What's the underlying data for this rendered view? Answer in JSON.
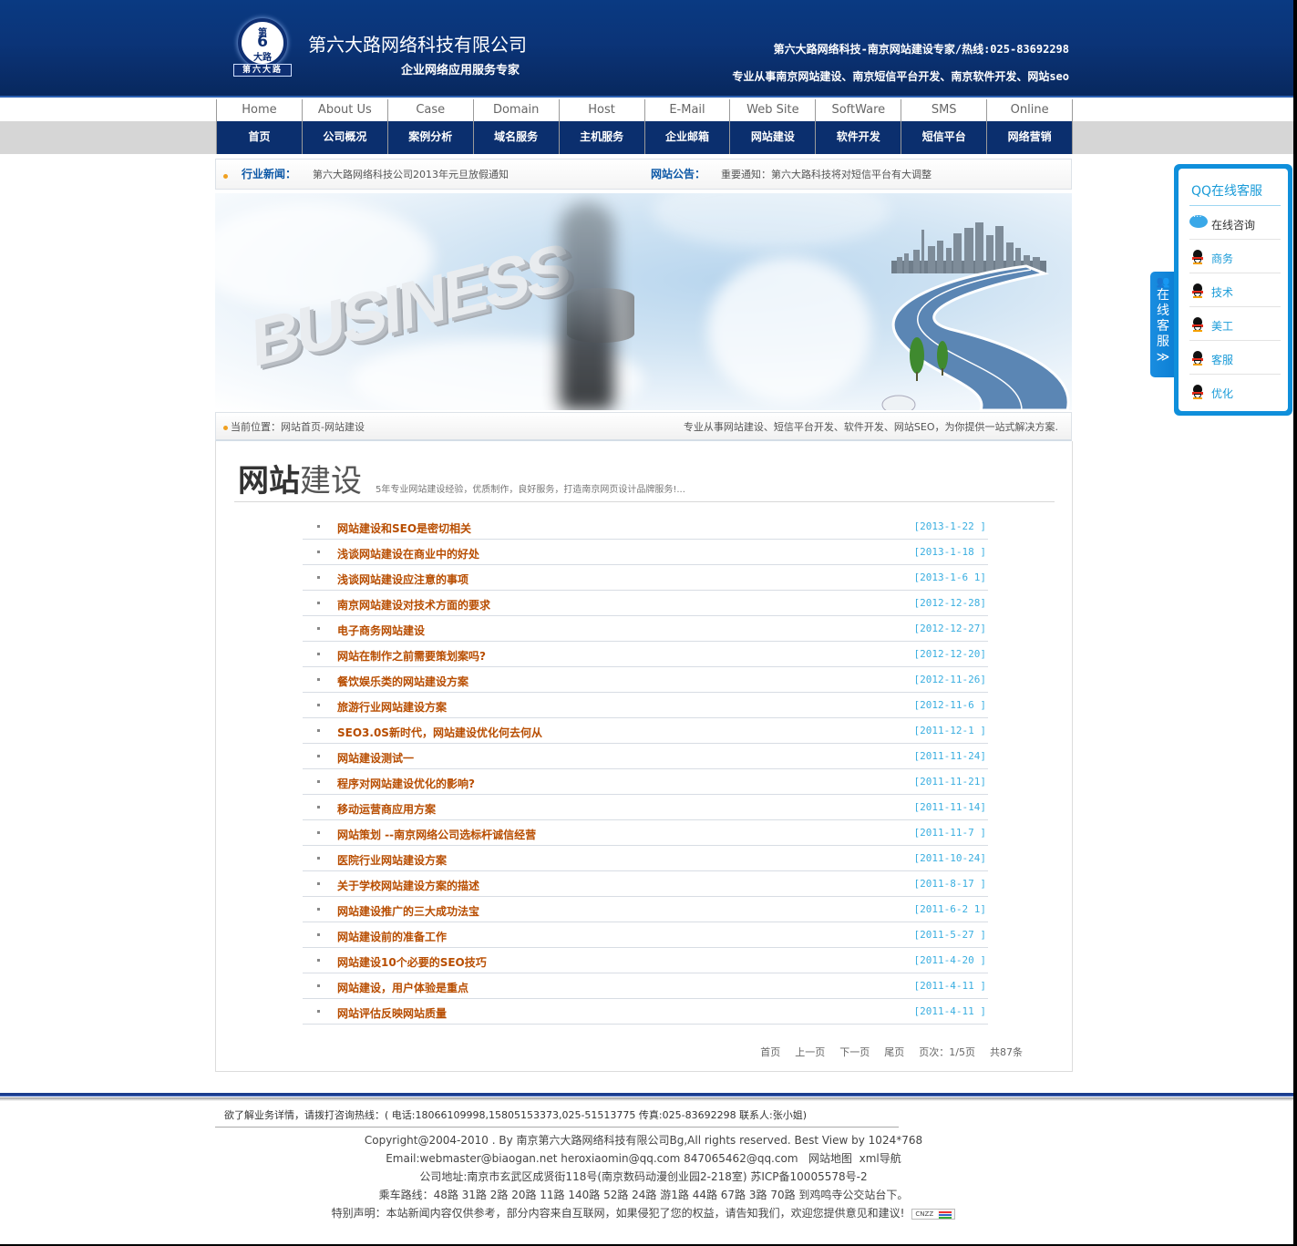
{
  "header": {
    "logo": {
      "circle_top": "第",
      "circle_num": "6",
      "circle_bottom": "大路",
      "band": "第六大路"
    },
    "company_name": "第六大路网络科技有限公司",
    "slogan": "企业网络应用服务专家",
    "hotline": "第六大路网络科技-南京网站建设专家/热线:025-83692298",
    "services": "专业从事南京网站建设、南京短信平台开发、南京软件开发、网站seo"
  },
  "nav": [
    {
      "en": "Home",
      "cn": "首页"
    },
    {
      "en": "About Us",
      "cn": "公司概况"
    },
    {
      "en": "Case",
      "cn": "案例分析"
    },
    {
      "en": "Domain",
      "cn": "域名服务"
    },
    {
      "en": "Host",
      "cn": "主机服务"
    },
    {
      "en": "E-Mail",
      "cn": "企业邮箱"
    },
    {
      "en": "Web Site",
      "cn": "网站建设"
    },
    {
      "en": "SoftWare",
      "cn": "软件开发"
    },
    {
      "en": "SMS",
      "cn": "短信平台"
    },
    {
      "en": "Online",
      "cn": "网络营销"
    }
  ],
  "newsbar": {
    "industry_label": "行业新闻：",
    "industry_text": "第六大路网络科技公司2013年元旦放假通知",
    "notice_label": "网站公告：",
    "notice_text": "重要通知：第六大路科技将对短信平台有大调整"
  },
  "banner": {
    "word": "BUSINESS"
  },
  "breadcrumb": {
    "text": "当前位置：网站首页-网站建设",
    "tagline": "专业从事网站建设、短信平台开发、软件开发、网站SEO，为你提供一站式解决方案."
  },
  "section": {
    "title_bold": "网站",
    "title_light": "建设",
    "subtitle": "5年专业网站建设经验，优质制作，良好服务，打造南京网页设计品牌服务!..."
  },
  "articles": [
    {
      "title": "网站建设和SEO是密切相关",
      "date": "[2013-1-22 ]"
    },
    {
      "title": "浅谈网站建设在商业中的好处",
      "date": "[2013-1-18 ]"
    },
    {
      "title": "浅谈网站建设应注意的事项",
      "date": "[2013-1-6 1]"
    },
    {
      "title": "南京网站建设对技术方面的要求",
      "date": "[2012-12-28]"
    },
    {
      "title": "电子商务网站建设",
      "date": "[2012-12-27]"
    },
    {
      "title": "网站在制作之前需要策划案吗?",
      "date": "[2012-12-20]"
    },
    {
      "title": "餐饮娱乐类的网站建设方案",
      "date": "[2012-11-26]"
    },
    {
      "title": "旅游行业网站建设方案",
      "date": "[2012-11-6 ]"
    },
    {
      "title": "SEO3.0S新时代，网站建设优化何去何从",
      "date": "[2011-12-1 ]"
    },
    {
      "title": "网站建设测试一",
      "date": "[2011-11-24]"
    },
    {
      "title": "程序对网站建设优化的影响?",
      "date": "[2011-11-21]"
    },
    {
      "title": "移动运营商应用方案",
      "date": "[2011-11-14]"
    },
    {
      "title": "网站策划 --南京网络公司选标杆诚信经营",
      "date": "[2011-11-7 ]"
    },
    {
      "title": "医院行业网站建设方案",
      "date": "[2011-10-24]"
    },
    {
      "title": "关于学校网站建设方案的描述",
      "date": "[2011-8-17 ]"
    },
    {
      "title": "网站建设推广的三大成功法宝",
      "date": "[2011-6-2 1]"
    },
    {
      "title": "网站建设前的准备工作",
      "date": "[2011-5-27 ]"
    },
    {
      "title": "网站建设10个必要的SEO技巧",
      "date": "[2011-4-20 ]"
    },
    {
      "title": "网站建设，用户体验是重点",
      "date": "[2011-4-11 ]"
    },
    {
      "title": "网站评估反映网站质量",
      "date": "[2011-4-11 ]"
    }
  ],
  "pager": {
    "first": "首页",
    "prev": "上一页",
    "next": "下一页",
    "last": "尾页",
    "page_info": "页次：1/5页",
    "total": "共87条"
  },
  "footer": {
    "contact": "欲了解业务详情，请拨打咨询热线：( 电话:18066109998,15805153373,025-51513775 传真:025-83692298 联系人:张小姐)",
    "copyright": "Copyright@2004-2010 . By 南京第六大路网络科技有限公司Bg,All rights reserved. Best View by 1024*768",
    "email_prefix": "Email:webmaster@biaogan.net  heroxiaomin@qq.com  847065462@qq.com",
    "sitemap": "网站地图",
    "xml_nav": "xml导航",
    "address": "公司地址:南京市玄武区成贤街118号(南京数码动漫创业园2-218室) 苏ICP备10005578号-2",
    "bus": "乘车路线：48路 31路 2路 20路 11路 140路 52路 24路 游1路 44路 67路 3路 70路 到鸡鸣寺公交站台下。",
    "disclaimer": "特别声明：本站新闻内容仅供参考，部分内容来自互联网，如果侵犯了您的权益，请告知我们，欢迎您提供意见和建议!",
    "cnzz": "CNZZ"
  },
  "qq": {
    "tab_label": [
      "在",
      "线",
      "客",
      "服"
    ],
    "tab_arrow": "≫",
    "title": "QQ在线客服",
    "consult": "在线咨询",
    "contacts": [
      "商务",
      "技术",
      "美工",
      "客服",
      "优化"
    ]
  },
  "colors": {
    "header_blue": "#0b3478",
    "nav_blue": "#0b2f6e",
    "link_orange": "#b84d00",
    "date_blue": "#3aaee0",
    "qq_blue": "#0f8fdb"
  }
}
